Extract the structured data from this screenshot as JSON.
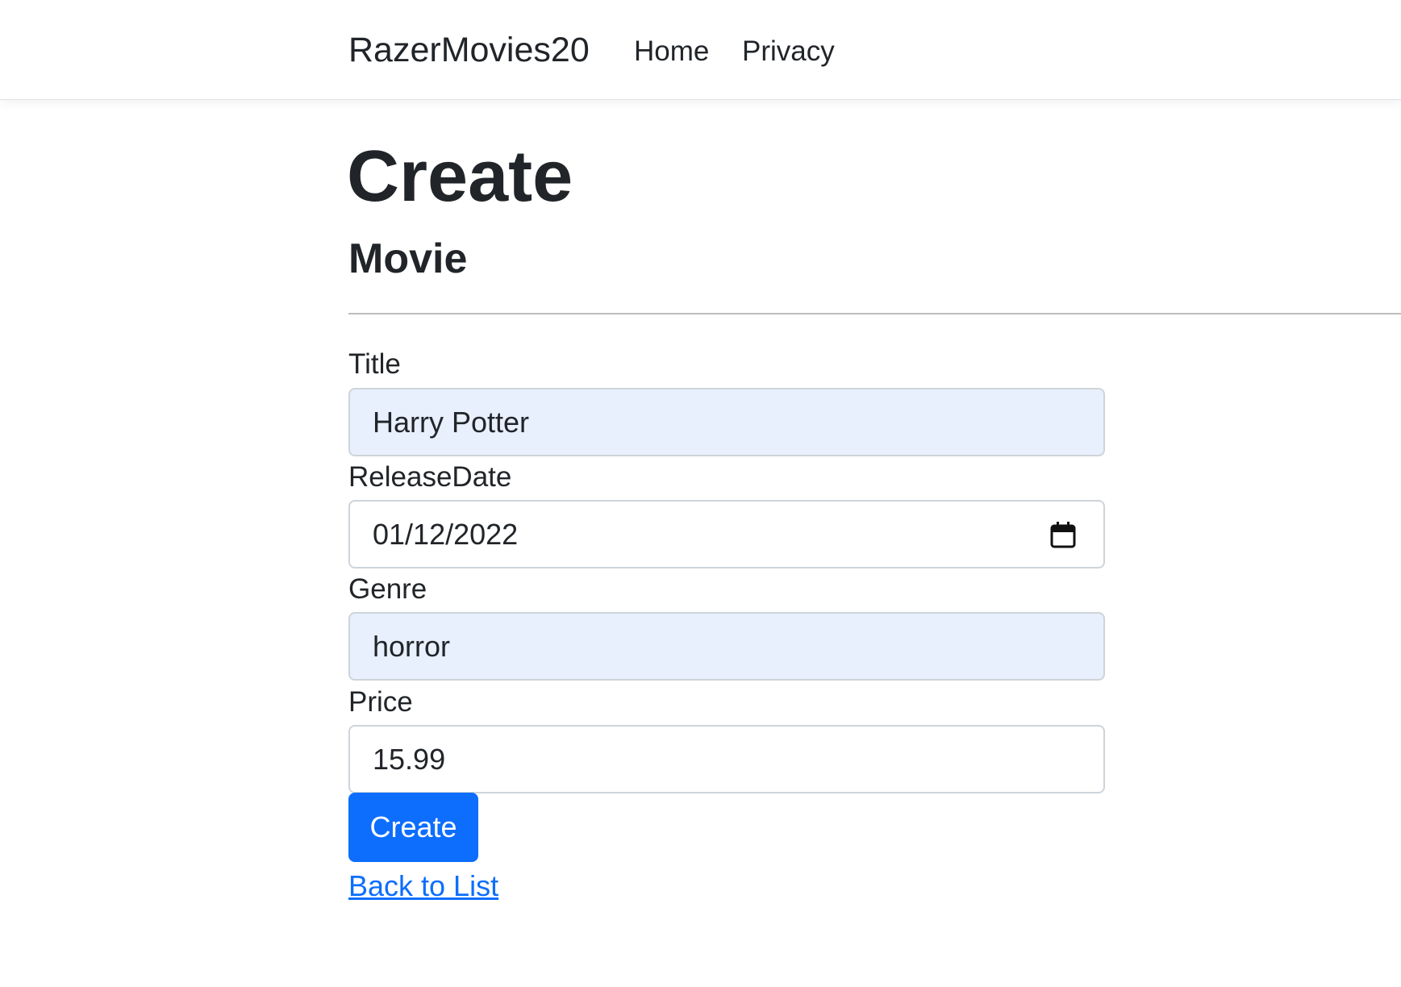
{
  "navbar": {
    "brand": "RazerMovies20",
    "links": [
      {
        "label": "Home"
      },
      {
        "label": "Privacy"
      }
    ]
  },
  "page": {
    "title": "Create",
    "subtitle": "Movie"
  },
  "form": {
    "fields": [
      {
        "label": "Title",
        "value": "Harry Potter"
      },
      {
        "label": "ReleaseDate",
        "value": "01/12/2022"
      },
      {
        "label": "Genre",
        "value": "horror"
      },
      {
        "label": "Price",
        "value": "15.99"
      }
    ],
    "submit_label": "Create",
    "back_link": "Back to List"
  },
  "colors": {
    "primary": "#0d6efd",
    "autofill_background": "#e8f0fe",
    "text": "#212529"
  },
  "icons": {
    "date_picker": "calendar-icon"
  }
}
